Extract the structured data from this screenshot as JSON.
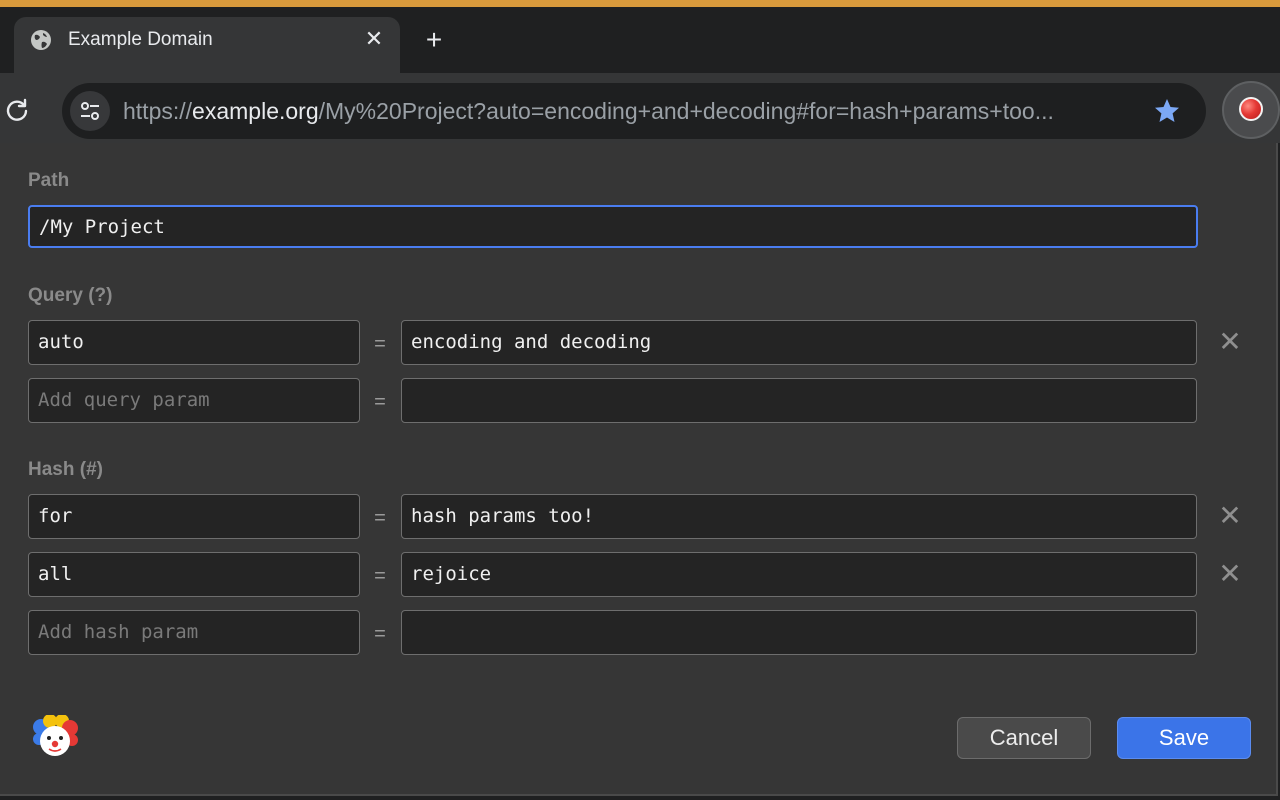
{
  "browser": {
    "tab": {
      "title": "Example Domain",
      "close_glyph": "✕"
    },
    "new_tab_glyph": "+",
    "url": {
      "scheme": "https://",
      "host": "example.org",
      "rest": "/My%20Project?auto=encoding+and+decoding#for=hash+params+too..."
    },
    "accent_color": "#d99a3c"
  },
  "editor": {
    "path": {
      "label": "Path",
      "value": "/My Project"
    },
    "query": {
      "label": "Query (?)",
      "params": [
        {
          "key": "auto",
          "value": "encoding and decoding"
        }
      ],
      "add_placeholder": "Add query param"
    },
    "hash": {
      "label": "Hash (#)",
      "params": [
        {
          "key": "for",
          "value": "hash params too!"
        },
        {
          "key": "all",
          "value": "rejoice"
        }
      ],
      "add_placeholder": "Add hash param"
    },
    "equals": "=",
    "remove_glyph": "✕",
    "actions": {
      "cancel": "Cancel",
      "save": "Save"
    },
    "colors": {
      "focus": "#4a7df0",
      "save_button": "#3b74e8"
    }
  },
  "icons": [
    "globe-icon",
    "close-icon",
    "plus-icon",
    "reload-icon",
    "site-settings-icon",
    "star-icon",
    "record-icon",
    "clown-logo-icon",
    "remove-icon"
  ]
}
